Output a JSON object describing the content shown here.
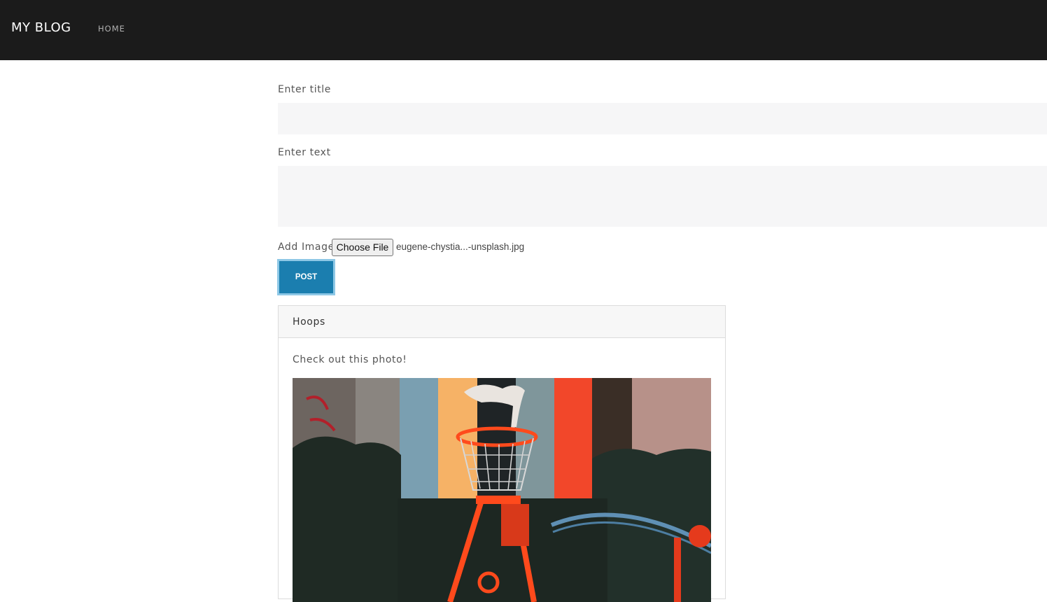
{
  "nav": {
    "brand": "MY BLOG",
    "home": "HOME"
  },
  "form": {
    "title_label": "Enter title",
    "title_value": "",
    "text_label": "Enter text",
    "text_value": "",
    "image_label": "Add Image",
    "file_button": "Choose File",
    "file_name": "eugene-chystia...-unsplash.jpg",
    "post_button": "POST"
  },
  "post": {
    "title": "Hoops",
    "body": "Check out this photo!",
    "image_icon": "basketball-hoop-photo"
  },
  "colors": {
    "navbar": "#1b1b1b",
    "accent": "#1b7eaf",
    "field_bg": "#f6f6f7"
  }
}
